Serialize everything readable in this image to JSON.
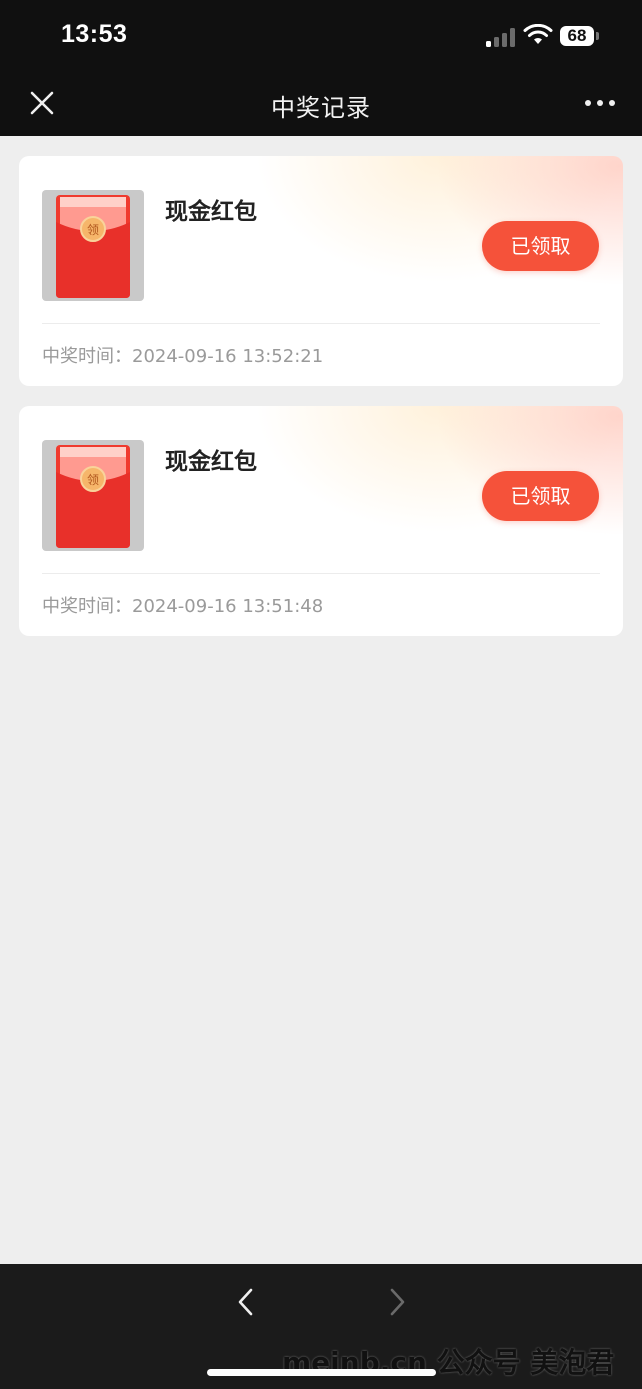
{
  "status_bar": {
    "time": "13:53",
    "battery": "68",
    "icons": [
      "signal-icon",
      "wifi-icon",
      "battery-icon"
    ]
  },
  "nav": {
    "title": "中奖记录",
    "close_icon": "close-icon",
    "more_icon": "more-icon"
  },
  "records": [
    {
      "title": "现金红包",
      "button": "已领取",
      "time_label": "中奖时间：",
      "time": "2024-09-16 13:52:21"
    },
    {
      "title": "现金红包",
      "button": "已领取",
      "time_label": "中奖时间：",
      "time": "2024-09-16 13:51:48"
    }
  ],
  "thumb_badge": "领",
  "toolbar": {
    "back_icon": "chevron-left-icon",
    "forward_icon": "chevron-right-icon"
  },
  "watermark": "meinb.cn  公众号 美泡君",
  "colors": {
    "accent": "#f5523a",
    "nav_background": "#101010",
    "page_background": "#eeeeee",
    "packet_red": "#f03a2e",
    "coin_gold": "#f6b66a"
  }
}
